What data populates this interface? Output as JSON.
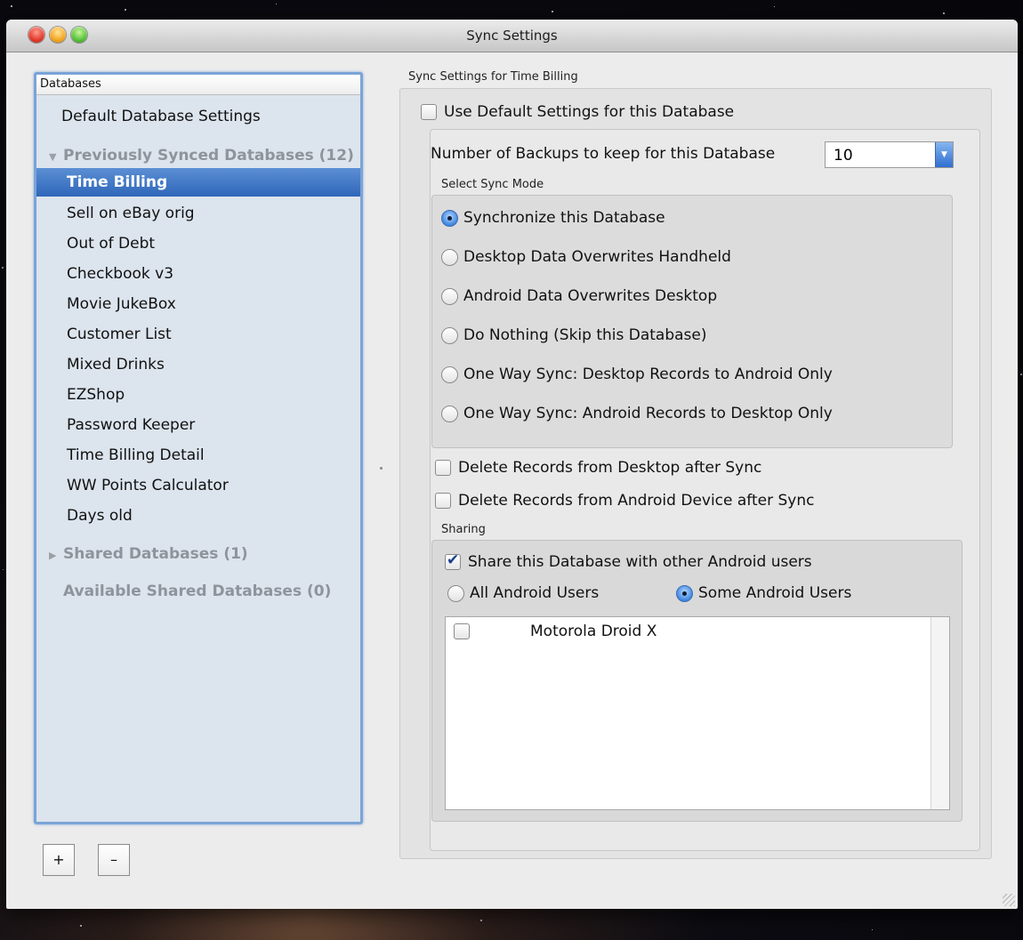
{
  "window": {
    "title": "Sync Settings"
  },
  "sidebar": {
    "header": "Databases",
    "default_item": "Default Database Settings",
    "previously_synced": {
      "label": "Previously Synced Databases (12)",
      "expanded": true,
      "items": [
        "Time Billing",
        "Sell on eBay orig",
        "Out of Debt",
        "Checkbook v3",
        "Movie JukeBox",
        "Customer List",
        "Mixed Drinks",
        "EZShop",
        "Password Keeper",
        "Time Billing Detail",
        "WW Points Calculator",
        "Days old"
      ],
      "selected_index": 0
    },
    "shared": {
      "label": "Shared Databases (1)",
      "expanded": false
    },
    "available_shared": {
      "label": "Available Shared Databases (0)"
    },
    "add_label": "+",
    "remove_label": "–"
  },
  "settings": {
    "group_label": "Sync Settings for Time Billing",
    "use_default": {
      "label": "Use Default Settings for this Database",
      "checked": false
    },
    "backups": {
      "label": "Number of Backups to keep for this Database",
      "value": "10"
    },
    "sync_mode": {
      "label": "Select Sync Mode",
      "options": [
        "Synchronize this Database",
        "Desktop Data Overwrites Handheld",
        "Android Data Overwrites Desktop",
        "Do Nothing (Skip this Database)",
        "One Way Sync: Desktop Records to Android Only",
        "One Way Sync: Android Records to Desktop Only"
      ],
      "selected_index": 0
    },
    "delete_desktop": {
      "label": "Delete Records from Desktop after Sync",
      "checked": false
    },
    "delete_android": {
      "label": "Delete Records from Android Device after Sync",
      "checked": false
    },
    "sharing": {
      "label": "Sharing",
      "share_checkbox": {
        "label": "Share this Database with other Android users",
        "checked": true
      },
      "all_users": {
        "label": "All Android Users",
        "selected": false
      },
      "some_users": {
        "label": "Some Android Users",
        "selected": true
      },
      "devices": [
        {
          "name": "Motorola Droid X",
          "checked": false
        }
      ]
    }
  }
}
